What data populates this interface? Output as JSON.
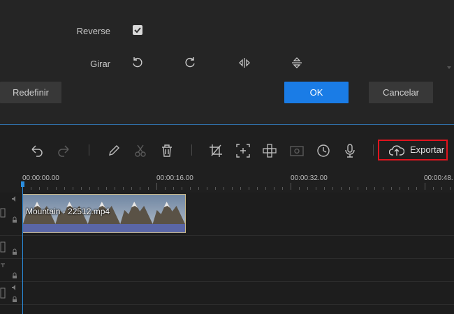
{
  "settings": {
    "reverse_label": "Reverse",
    "reverse_checked": true,
    "rotate_label": "Girar",
    "rotate_icons": [
      "rotate-left-icon",
      "rotate-right-icon",
      "flip-horizontal-icon",
      "flip-vertical-icon"
    ]
  },
  "buttons": {
    "reset": "Redefinir",
    "ok": "OK",
    "cancel": "Cancelar"
  },
  "toolbar": {
    "icons": [
      "undo-icon",
      "redo-icon",
      "pencil-icon",
      "scissors-icon",
      "trash-icon",
      "crop-icon",
      "zoom-fit-icon",
      "mosaic-icon",
      "freeze-frame-icon",
      "speed-clock-icon",
      "microphone-icon"
    ],
    "export_label": "Exportar"
  },
  "ruler": {
    "labels": [
      "00:00:00.00",
      "00:00:16.00",
      "00:00:32.00",
      "00:00:48."
    ]
  },
  "timeline": {
    "clip_name": "Mountain - 22512.mp4"
  },
  "colors": {
    "accent": "#1a7ce6",
    "highlight_box": "#e0141e",
    "playhead": "#2a8ee0"
  }
}
